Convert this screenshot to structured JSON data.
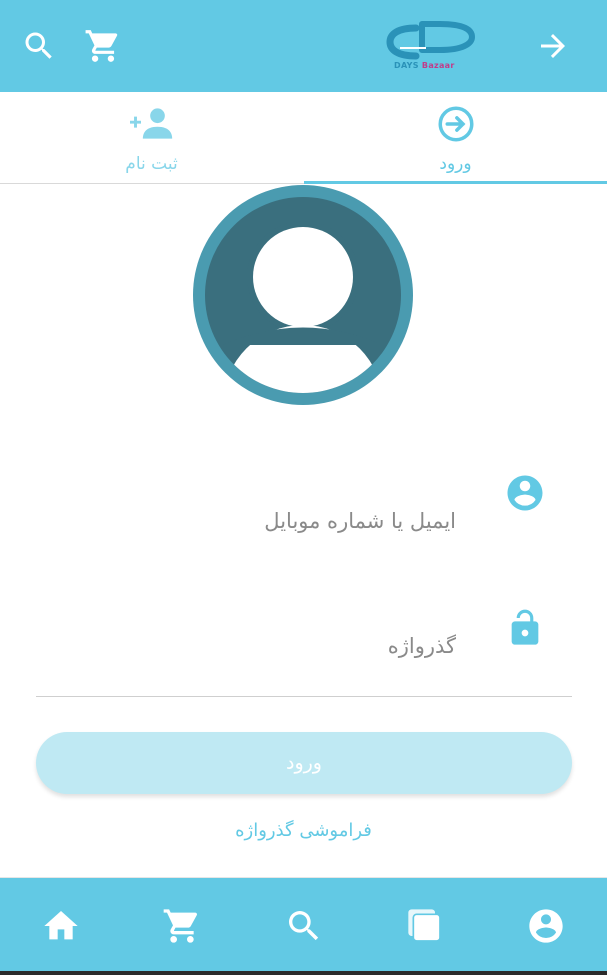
{
  "header": {
    "logo_text_primary": "DAYS",
    "logo_text_secondary": "Bazaar",
    "icons": [
      "search-icon",
      "cart-icon",
      "arrow-forward-icon"
    ]
  },
  "tabs": [
    {
      "label": "ثبت نام",
      "icon": "person-add-icon",
      "active": false
    },
    {
      "label": "ورود",
      "icon": "login-icon",
      "active": true
    }
  ],
  "form": {
    "email_placeholder": "ایمیل یا شماره موبایل",
    "email_value": "",
    "password_placeholder": "گذرواژه",
    "password_value": "",
    "login_button_label": "ورود",
    "forgot_password_label": "فراموشی گذرواژه"
  },
  "bottom_nav": {
    "items": [
      "home-icon",
      "cart-icon",
      "search-icon",
      "pages-icon",
      "profile-icon"
    ]
  },
  "colors": {
    "primary": "#62c9e4",
    "button_disabled": "#bfe9f3",
    "avatar_dark": "#3a6f7e",
    "avatar_ring": "#4a9bb0"
  }
}
